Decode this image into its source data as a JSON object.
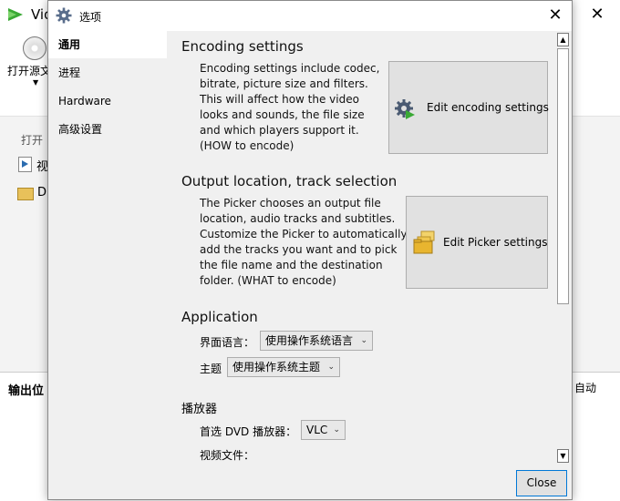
{
  "background": {
    "app_title": "Vid",
    "open_source_label": "打开源文",
    "open_text": "打开",
    "items": [
      "视",
      "D"
    ],
    "output_label": "输出位",
    "auto_label": "自动"
  },
  "dialog": {
    "title": "选项",
    "nav": [
      {
        "label": "通用",
        "active": true
      },
      {
        "label": "进程",
        "active": false
      },
      {
        "label": "Hardware",
        "active": false
      },
      {
        "label": "高级设置",
        "active": false
      }
    ],
    "encoding": {
      "heading": "Encoding settings",
      "lines": [
        "Encoding settings include codec,",
        "bitrate, picture size and filters.",
        "This will affect how the video",
        "looks and sounds, the file size",
        "and which players support it.",
        "(HOW to encode)"
      ],
      "button_label": "Edit encoding settings"
    },
    "output": {
      "heading": "Output location, track selection",
      "lines": [
        "The Picker chooses an output file",
        "location, audio tracks and subtitles.",
        "Customize the Picker to automatically",
        "add the tracks you want and to pick",
        "the file name and the destination",
        "folder. (WHAT to encode)"
      ],
      "button_label": "Edit Picker settings"
    },
    "application": {
      "heading": "Application",
      "language_label": "界面语言：",
      "language_value": "使用操作系统语言",
      "theme_label": "主题",
      "theme_value": "使用操作系统主题"
    },
    "player": {
      "heading": "播放器",
      "dvd_label": "首选 DVD 播放器：",
      "dvd_value": "VLC",
      "video_label": "视频文件："
    },
    "close_label": "Close"
  },
  "colors": {
    "accent": "#0078d7",
    "active_nav_bg": "#ffffff",
    "dialog_bg": "#f0f0f0",
    "button_bg": "#e1e1e1"
  },
  "icons": {
    "title": "gear-icon",
    "encoding_button": "gear-play-icon",
    "picker_button": "folder-stack-icon",
    "close": "close-icon"
  }
}
